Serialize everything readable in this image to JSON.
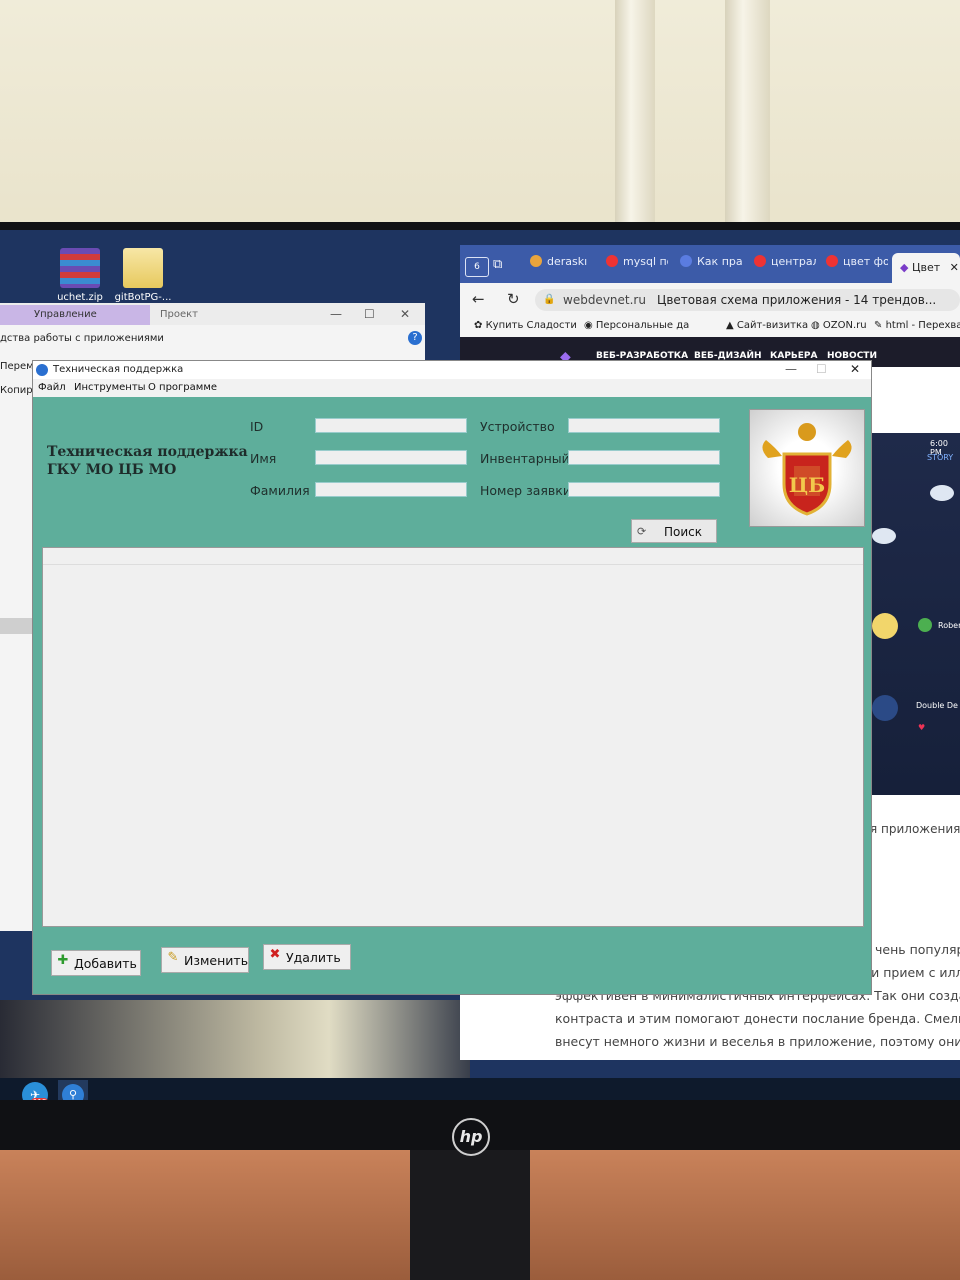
{
  "desktop": {
    "icons": [
      {
        "label": "uchet.zip",
        "icon": "winrar-archive-icon"
      },
      {
        "label": "gitBotPG-...",
        "icon": "folder-icon"
      }
    ]
  },
  "explorer": {
    "tab_manage": "Управление",
    "tab_project": "Проект",
    "ribbon_line": "дства работы с приложениями",
    "item_move": "Переме",
    "item_copy": "Копиро"
  },
  "browser": {
    "tabs": [
      {
        "label": "deraskı"
      },
      {
        "label": "mysql по"
      },
      {
        "label": "Как пра"
      },
      {
        "label": "централ"
      },
      {
        "label": "цвет фо"
      }
    ],
    "active_tab": "Цвет",
    "url_domain": "webdevnet.ru",
    "page_title": "Цветовая схема приложения - 14 трендов...",
    "bookmarks": [
      "Купить Сладости",
      "Персональные да",
      "Сайт-визитка",
      "OZON.ru",
      "html - Перехват"
    ],
    "site_nav": [
      "ВЕБ-РАЗРАБОТКА",
      "ВЕБ-ДИЗАЙН",
      "КАРЬЕРА",
      "НОВОСТИ"
    ],
    "phone": {
      "time": "6:00 PM",
      "story": "STORY",
      "user": "Rober",
      "event": "Double De"
    },
    "article_fragment": "я приложения",
    "article_lines": [
      "чень популярн",
      "дизайне мобильных приложений. В особенности прием с иллю",
      "эффективен в минималистичных интерфейсах. Так они создают",
      "контраста и этим помогают донести послание бренда. Смелые",
      "внесут немного жизни и веселья в приложение, поэтому они та"
    ]
  },
  "app": {
    "window_title": "Техническая поддержка",
    "menu": [
      "Файл",
      "Инструменты",
      "О программе"
    ],
    "org_title_line1": "Техническая поддержка",
    "org_title_line2": "ГКУ МО ЦБ МО",
    "fields_left": [
      {
        "label": "ID",
        "value": ""
      },
      {
        "label": "Имя",
        "value": ""
      },
      {
        "label": "Фамилия",
        "value": ""
      }
    ],
    "fields_right": [
      {
        "label": "Устройство",
        "value": ""
      },
      {
        "label": "Инвентарный",
        "value": ""
      },
      {
        "label": "Номер заявки",
        "value": ""
      }
    ],
    "logo_text": "ЦБ",
    "search_label": "Поиск",
    "actions": {
      "add": "Добавить",
      "edit": "Изменить",
      "delete": "Удалить"
    },
    "colors": {
      "background": "#5eae9b",
      "grid": "#f0f0f0"
    }
  },
  "monitor": {
    "brand": "hp"
  },
  "taskbar": {
    "badge": "118"
  }
}
